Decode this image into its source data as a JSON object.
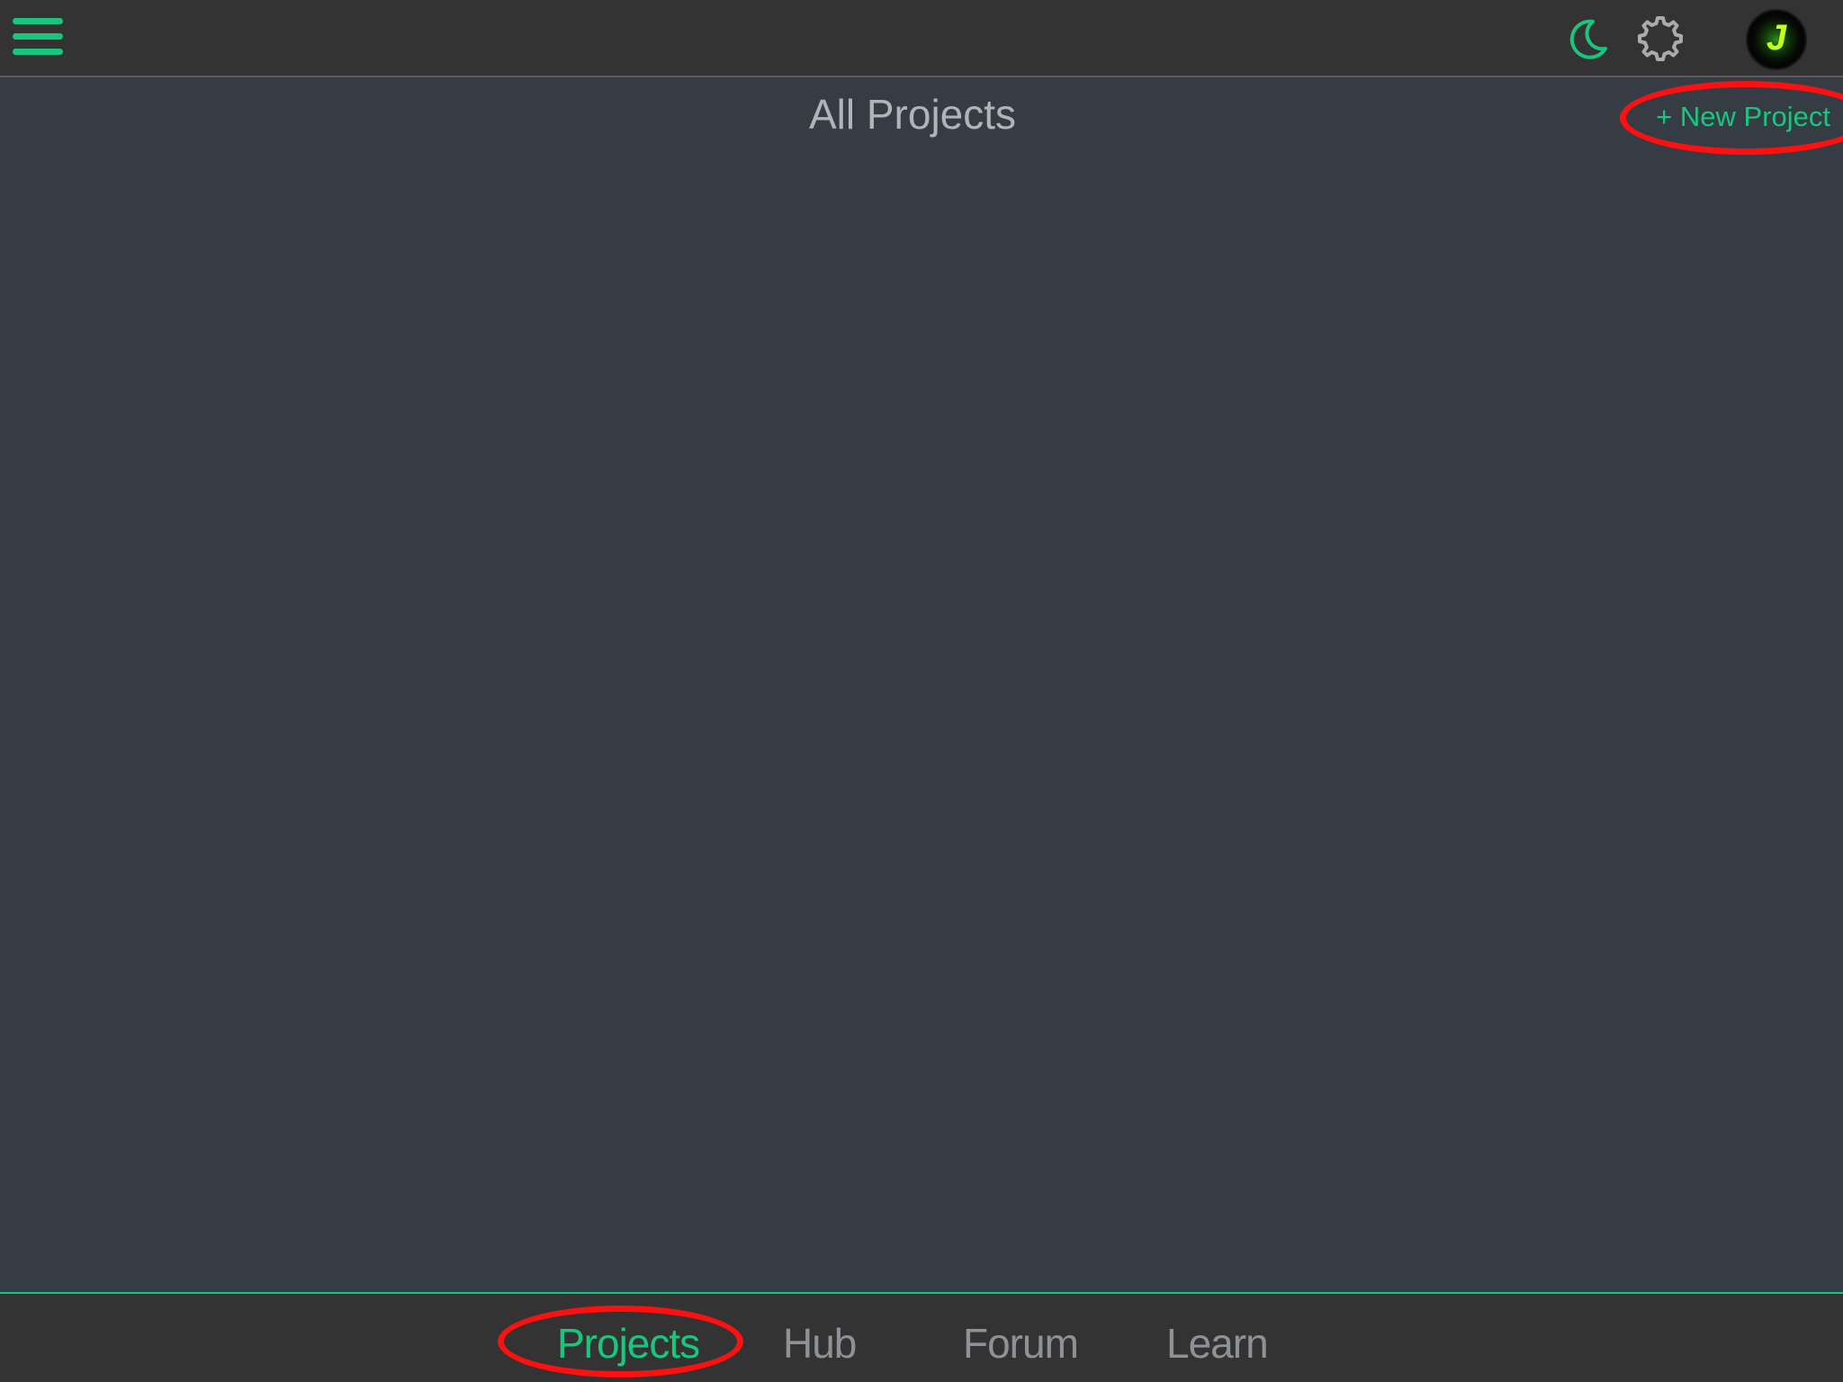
{
  "topbar": {
    "menu_icon": "hamburger-menu-icon",
    "theme_icon": "moon-icon",
    "settings_icon": "gear-icon",
    "avatar_letter": "J"
  },
  "header": {
    "title": "All Projects",
    "new_project_label": "+ New Project"
  },
  "tabs": [
    {
      "label": "Projects",
      "active": true
    },
    {
      "label": "Hub",
      "active": false
    },
    {
      "label": "Forum",
      "active": false
    },
    {
      "label": "Learn",
      "active": false
    }
  ],
  "colors": {
    "accent": "#18c77d",
    "background": "#363c44",
    "bars": "#333333",
    "annotation": "#ff1010"
  }
}
